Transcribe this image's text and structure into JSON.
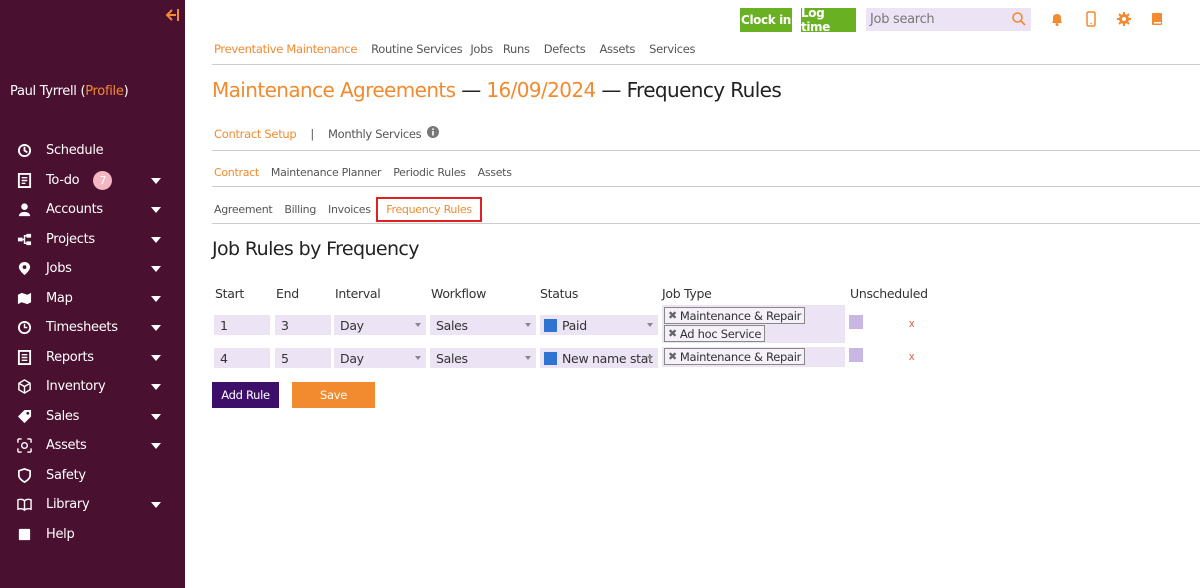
{
  "sidebar": {
    "collapse_icon": "arrow-left-bar-icon",
    "user_name": "Paul Tyrrell",
    "profile_label": "Profile",
    "items": [
      {
        "label": "Schedule",
        "icon": "schedule-icon",
        "caret": false
      },
      {
        "label": "To-do",
        "icon": "todo-icon",
        "caret": true,
        "badge": "7"
      },
      {
        "label": "Accounts",
        "icon": "accounts-icon",
        "caret": true
      },
      {
        "label": "Projects",
        "icon": "projects-icon",
        "caret": true
      },
      {
        "label": "Jobs",
        "icon": "jobs-icon",
        "caret": true
      },
      {
        "label": "Map",
        "icon": "map-icon",
        "caret": true
      },
      {
        "label": "Timesheets",
        "icon": "timesheets-icon",
        "caret": true
      },
      {
        "label": "Reports",
        "icon": "reports-icon",
        "caret": true
      },
      {
        "label": "Inventory",
        "icon": "inventory-icon",
        "caret": true
      },
      {
        "label": "Sales",
        "icon": "sales-icon",
        "caret": true
      },
      {
        "label": "Assets",
        "icon": "assets-icon",
        "caret": true
      },
      {
        "label": "Safety",
        "icon": "safety-icon",
        "caret": false
      },
      {
        "label": "Library",
        "icon": "library-icon",
        "caret": true
      },
      {
        "label": "Help",
        "icon": "help-icon",
        "caret": false
      }
    ]
  },
  "topbar": {
    "clock_in": "Clock in",
    "log_time": "Log time",
    "search_placeholder": "Job search"
  },
  "nav_main": {
    "items": [
      "Preventative Maintenance",
      "Routine Services",
      "Jobs",
      "Runs",
      "Defects",
      "Assets",
      "Services"
    ],
    "active_index": 0
  },
  "page_title": {
    "part1": "Maintenance Agreements",
    "sep1": " — ",
    "part2": "16/09/2024",
    "sep2": " — ",
    "part3": "Frequency Rules"
  },
  "subnav1": {
    "items": [
      "Contract Setup",
      "|",
      "Monthly Services"
    ]
  },
  "subnav2": {
    "items": [
      "Contract",
      "Maintenance Planner",
      "Periodic Rules",
      "Assets"
    ]
  },
  "subnav3": {
    "items": [
      "Agreement",
      "Billing",
      "Invoices",
      "Frequency Rules"
    ]
  },
  "section_title": "Job Rules by Frequency",
  "table": {
    "headers": [
      "Start",
      "End",
      "Interval",
      "Workflow",
      "Status",
      "Job Type",
      "Unscheduled"
    ],
    "rows": [
      {
        "start": "1",
        "end": "3",
        "interval": "Day",
        "workflow": "Sales",
        "status": "Paid",
        "status_color": "#2f74d0",
        "job_types": [
          "Maintenance & Repair",
          "Ad hoc Service"
        ],
        "delete": "x"
      },
      {
        "start": "4",
        "end": "5",
        "interval": "Day",
        "workflow": "Sales",
        "status": "New name stat",
        "status_color": "#2f74d0",
        "job_types": [
          "Maintenance & Repair"
        ],
        "delete": "x"
      }
    ]
  },
  "buttons": {
    "add_rule": "Add Rule",
    "save": "Save"
  },
  "colors": {
    "sidebar": "#4a1030",
    "accent": "#f28a30",
    "green": "#6ab023",
    "purple": "#3d0f6b",
    "highlight": "#e02020"
  }
}
